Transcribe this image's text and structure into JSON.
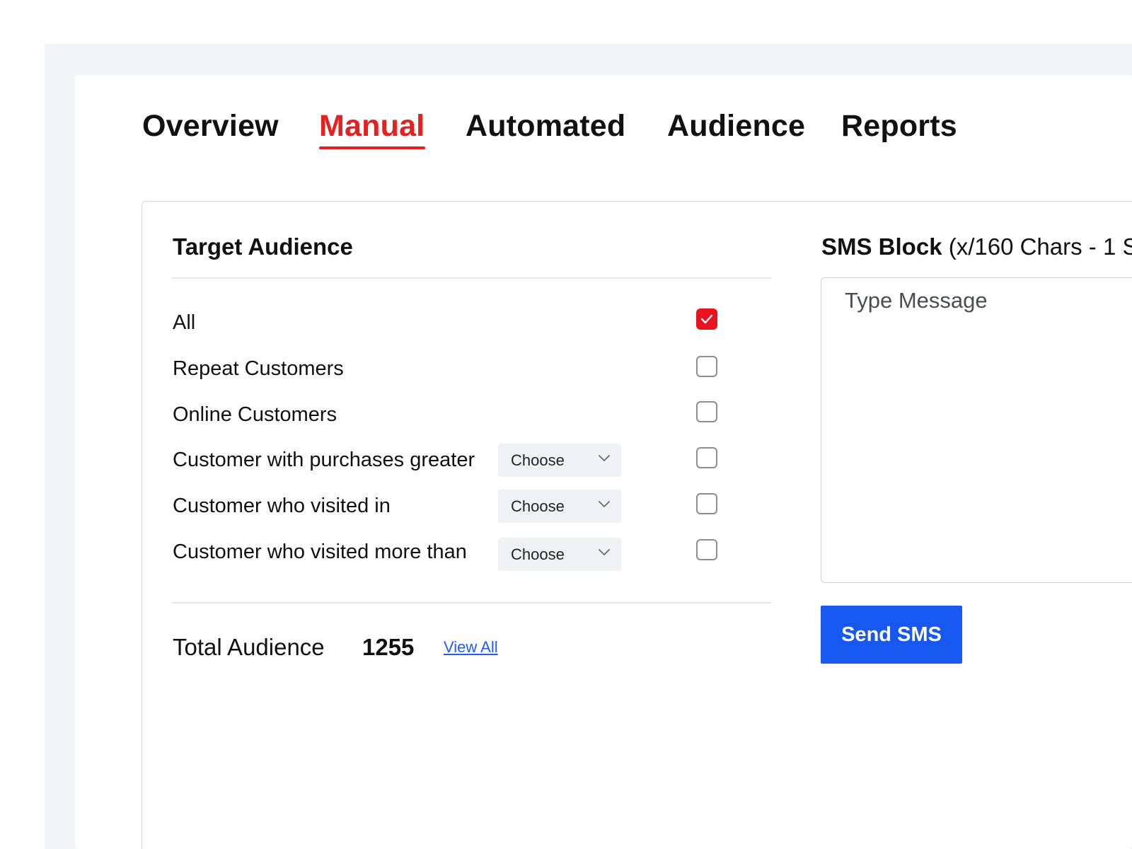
{
  "tabs": {
    "overview": "Overview",
    "manual": "Manual",
    "automated": "Automated",
    "audience": "Audience",
    "reports": "Reports",
    "active": "Manual"
  },
  "target_audience": {
    "title": "Target Audience",
    "rows": [
      {
        "label": "All",
        "checked": true
      },
      {
        "label": "Repeat Customers",
        "checked": false
      },
      {
        "label": "Online Customers",
        "checked": false
      },
      {
        "label": "Customer with purchases greater",
        "checked": false,
        "select": "Choose"
      },
      {
        "label": "Customer who visited in",
        "checked": false,
        "select": "Choose"
      },
      {
        "label": "Customer who visited more than",
        "checked": false,
        "select": "Choose"
      }
    ],
    "total_label": "Total Audience",
    "total_count": "1255",
    "view_all": "View All"
  },
  "sms": {
    "title_bold": "SMS Block",
    "title_rest": " (x/160 Chars - 1 S",
    "placeholder": "Type Message",
    "send_label": "Send SMS"
  },
  "colors": {
    "accent_red": "#e62020",
    "checkbox_red": "#e8131e",
    "button_blue": "#1658f0",
    "link_blue": "#1d5cff",
    "page_bg": "#f3f4f7"
  },
  "icons": {
    "checkmark": "check-icon",
    "dropdown": "chevron-down-icon"
  }
}
